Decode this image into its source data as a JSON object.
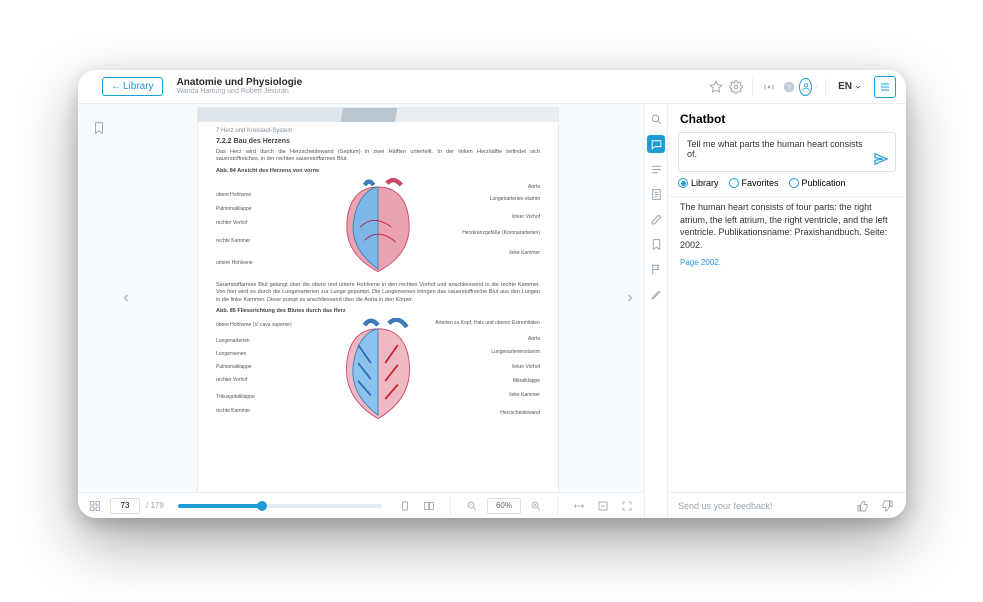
{
  "header": {
    "library_btn_label": "Library",
    "doc_title": "Anatomie und Physiologie",
    "doc_authors": "Wanda Hartung und Robert Jesuran",
    "language_label": "EN"
  },
  "rail": {
    "items": [
      {
        "name": "search-icon"
      },
      {
        "name": "chat-icon",
        "active": true
      },
      {
        "name": "toc-icon"
      },
      {
        "name": "notes-icon"
      },
      {
        "name": "edit-icon"
      },
      {
        "name": "bookmark-icon"
      },
      {
        "name": "flag-icon"
      },
      {
        "name": "highlight-icon"
      }
    ]
  },
  "reader": {
    "chapter_line": "7   Herz und Kreislauf-System",
    "section_heading": "7.2.2    Bau des Herzens",
    "section_para": "Das Herz wird durch die Herzscheidewand (Septum) in zwei Hälften unterteilt. In der linken Herzhälfte befindet sich sauerstoffreiches, in der rechten sauerstoffarmes Blut.",
    "fig1_caption": "Abb. 84    Ansicht des Herzens von vorne",
    "fig1_labels_left": [
      "obere Hohlvene",
      "Pulmonalklappe",
      "rechter Vorhof",
      "rechte Kammer",
      "untere Hohlvene"
    ],
    "fig1_labels_right": [
      "Aorta",
      "Lungenarterien-stamm",
      "linker Vorhof",
      "Herzkranzgefäße (Koronararterien)",
      "linke Kammer"
    ],
    "mid_para": "Sauerstoffarmes Blut gelangt über die obere und untere Hohlvene in den rechten Vorhof und anschliessend in die rechte Kammer. Von hier wird es durch die Lungenarterien zur Lunge gepumpt. Die Lungenvenen bringen das sauerstoffreiche Blut aus den Lungen in die linke Kammer. Diese pumpt es anschliessend über die Aorta in den Körper.",
    "fig2_caption": "Abb. 85    Fliessrichtung des Blutes durch das Herz",
    "fig2_labels_left": [
      "obere Hohlvene (V. cava superior)",
      "Lungenarterien",
      "Lungenvenen",
      "Pulmonalklappe",
      "rechter Vorhof",
      "Trikuspidalklappe",
      "rechte Kammer"
    ],
    "fig2_labels_right": [
      "Arterien zu Kopf, Hals und oberen Extremitäten",
      "Aorta",
      "Lungenarterienstamm",
      "linker Vorhof",
      "Mitralklappe",
      "linke Kammer",
      "Herzscheidewand"
    ]
  },
  "footer": {
    "current_page": "73",
    "total_pages": "/ 179",
    "zoom_pct": "60%",
    "slider_fill_pct": 41
  },
  "chatbot": {
    "title": "Chatbot",
    "input_value": "Tell me what parts the human heart consists of.",
    "scope_options": [
      "Library",
      "Favorites",
      "Publication"
    ],
    "scope_selected": 0,
    "answer_text": "The human heart consists of four parts: the right atrium, the left atrium, the right ventricle, and the left ventricle. Publikationsname: Praxishandbuch. Seite: 2002.",
    "answer_link": "Page 2002.",
    "feedback_prompt": "Send us your feedback!"
  }
}
